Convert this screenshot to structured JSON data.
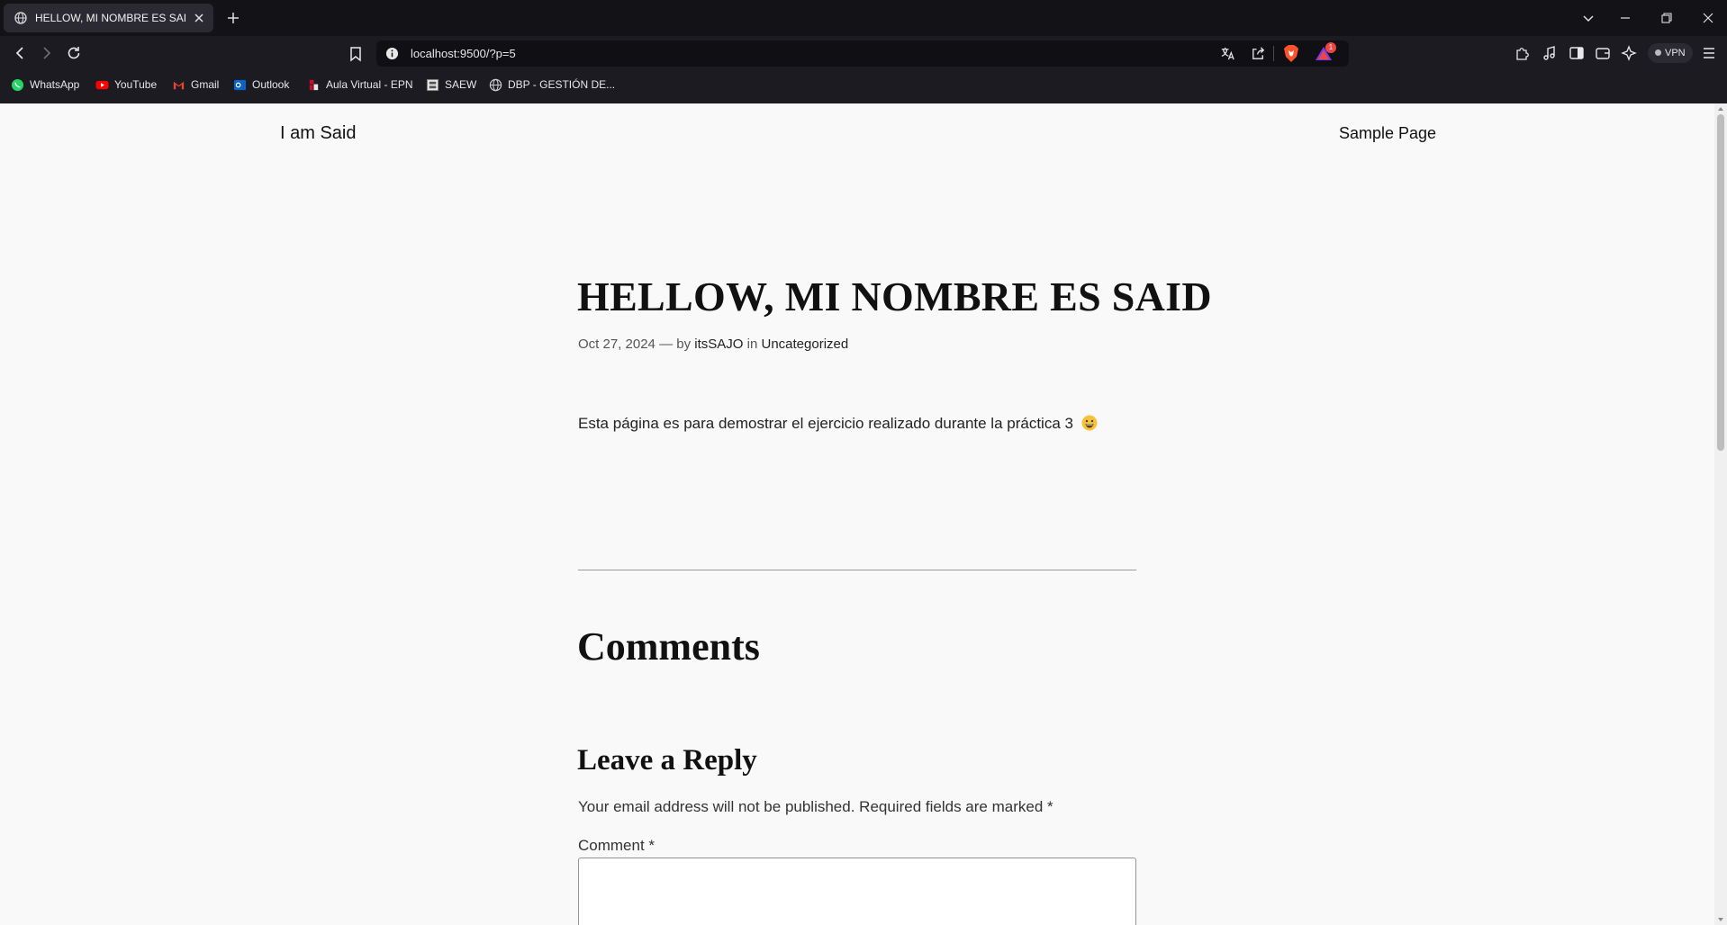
{
  "browser": {
    "tab_title": "HELLOW, MI NOMBRE ES SAID",
    "url": "localhost:9500/?p=5",
    "vpn_label": "VPN",
    "shields_badge": "1",
    "bookmarks": [
      {
        "label": "WhatsApp",
        "icon": "whatsapp-icon",
        "color": "#25d366"
      },
      {
        "label": "YouTube",
        "icon": "youtube-icon",
        "color": "#ff0000"
      },
      {
        "label": "Gmail",
        "icon": "gmail-icon",
        "color": "#ea4335"
      },
      {
        "label": "Outlook",
        "icon": "outlook-icon",
        "color": "#0a64c8"
      },
      {
        "label": "Aula Virtual - EPN",
        "icon": "aula-virtual-icon",
        "color": "#c8102e"
      },
      {
        "label": "SAEW",
        "icon": "saew-icon",
        "color": "#cccccc"
      },
      {
        "label": "DBP - GESTIÓN DE...",
        "icon": "globe-icon",
        "color": "#cccccc"
      }
    ]
  },
  "page": {
    "site_title": "I am Said",
    "nav": {
      "sample_page": "Sample Page"
    },
    "post": {
      "title": "HELLOW, MI NOMBRE ES SAID",
      "date": "Oct 27, 2024",
      "by_sep": "— by",
      "author": "itsSAJO",
      "in_sep": "in",
      "category": "Uncategorized",
      "body": "Esta página es para demostrar el ejercicio realizado durante la práctica 3",
      "emoji": "grinning-face-emoji"
    },
    "comments": {
      "heading": "Comments",
      "reply_heading": "Leave a Reply",
      "note": "Your email address will not be published. Required fields are marked *",
      "comment_label": "Comment *",
      "comment_value": ""
    }
  },
  "colors": {
    "page_bg": "#f9f9f9",
    "chrome_bg": "#1c1b22",
    "tab_bg": "#2b2a33"
  }
}
